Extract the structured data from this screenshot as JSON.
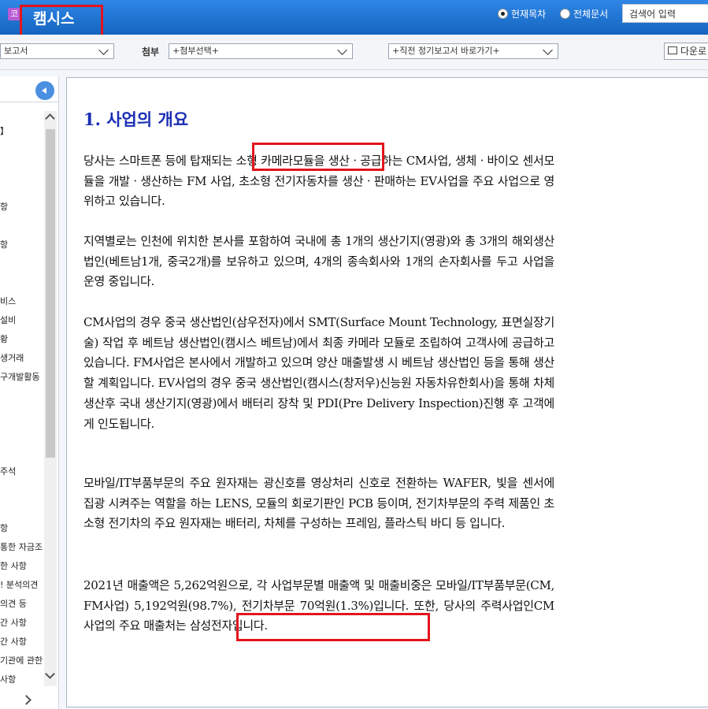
{
  "header": {
    "logo_glyph": "코",
    "company_name": "캠시스",
    "radio_current": "현재목차",
    "radio_all": "전체문서",
    "search_placeholder": "검색어 입력"
  },
  "toolbar": {
    "report_select": "보고서",
    "attach_label": "첨부",
    "attach_select": "+첨부선택+",
    "periodic_select": "+직전 정기보고서 바로가기+",
    "download_label": "다운로"
  },
  "sidebar": {
    "items": [
      "】",
      "항",
      "항",
      "비스",
      "설비",
      "황",
      "생거래",
      "구개발활동",
      "주석",
      "항",
      "통한 자금조",
      "한 사항",
      "! 분석의견",
      "의견 등",
      "간 사항",
      "간 사항",
      "기관에 관한",
      "사항"
    ]
  },
  "content": {
    "heading": "1. 사업의 개요",
    "paragraphs": [
      "당사는 스마트폰 등에 탑재되는 소형 카메라모듈을 생산ㆍ공급하는 CM사업, 생체ㆍ바이오 센서모듈을 개발ㆍ생산하는 FM 사업, 초소형 전기자동차를 생산ㆍ판매하는 EV사업을 주요 사업으로 영위하고 있습니다.",
      "지역별로는 인천에 위치한 본사를 포함하여 국내에 총 1개의 생산기지(영광)와 총 3개의 해외생산법인(베트남1개, 중국2개)를 보유하고 있으며, 4개의 종속회사와 1개의 손자회사를 두고 사업을 운영 중입니다.",
      "CM사업의 경우 중국 생산법인(삼우전자)에서 SMT(Surface Mount Technology, 표면실장기술) 작업 후 베트남 생산법인(캠시스 베트남)에서 최종 카메라 모듈로 조립하여 고객사에 공급하고 있습니다. FM사업은 본사에서 개발하고 있으며 양산 매출발생 시 베트남 생산법인 등을 통해 생산할 계획입니다. EV사업의 경우 중국 생산법인(캠시스(창저우)신능원 자동차유한회사)을 통해 차체 생산후 국내 생산기지(영광)에서 배터리 장착 및 PDI(Pre Delivery Inspection)진행 후 고객에게 인도됩니다.",
      "모바일/IT부품부문의 주요 원자재는 광신호를 영상처리 신호로 전환하는 WAFER, 빛을 센서에 집광 시켜주는 역할을 하는 LENS, 모듈의 회로기판인 PCB 등이며, 전기차부문의 주력 제품인 초소형 전기차의 주요 원자재는 배터리, 차체를 구성하는 프레임, 플라스틱 바디 등 입니다.",
      "2021년 매출액은 5,262억원으로, 각 사업부문별 매출액 및 매출비중은 모바일/IT부품부문(CM, FM사업) 5,192억원(98.7%), 전기차부문 70억원(1.3%)입니다. 또한, 당사의 주력사업인CM사업의 주요 매출처는 삼성전자입니다."
    ]
  },
  "colors": {
    "header_blue": "#1e73d6",
    "heading_blue": "#1b2fb4",
    "highlight_red": "#e3141b"
  }
}
